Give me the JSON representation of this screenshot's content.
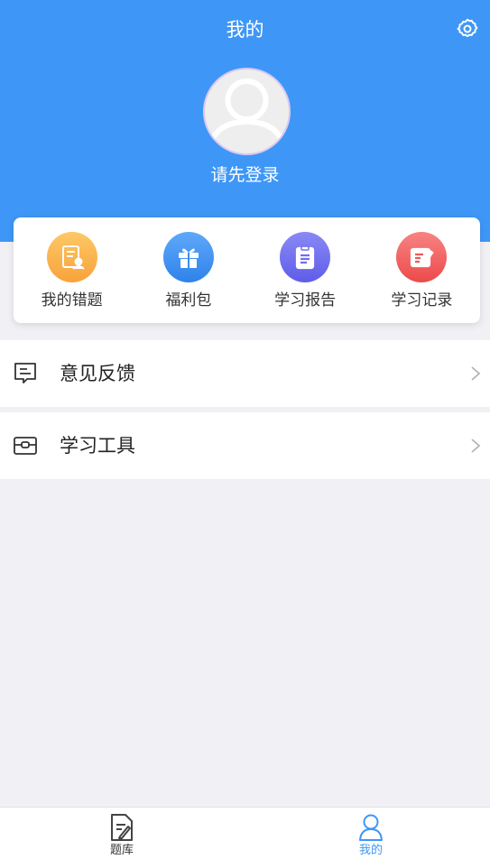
{
  "header": {
    "title": "我的",
    "login_text": "请先登录",
    "bg_color": "#3e97f6"
  },
  "quick_actions": [
    {
      "label": "我的错题",
      "icon": "wrong-questions-icon",
      "color": "#fbb040"
    },
    {
      "label": "福利包",
      "icon": "gift-icon",
      "color": "#3b8ff0"
    },
    {
      "label": "学习报告",
      "icon": "clipboard-report-icon",
      "color": "#6f6ef0"
    },
    {
      "label": "学习记录",
      "icon": "edit-record-icon",
      "color": "#f05a5a"
    }
  ],
  "menu": [
    {
      "label": "意见反馈",
      "icon": "feedback-icon"
    },
    {
      "label": "学习工具",
      "icon": "toolbox-icon"
    }
  ],
  "tabbar": {
    "active_color": "#3e97f6",
    "tabs": [
      {
        "label": "题库",
        "icon": "question-bank-icon",
        "active": false
      },
      {
        "label": "我的",
        "icon": "user-icon",
        "active": true
      }
    ]
  }
}
